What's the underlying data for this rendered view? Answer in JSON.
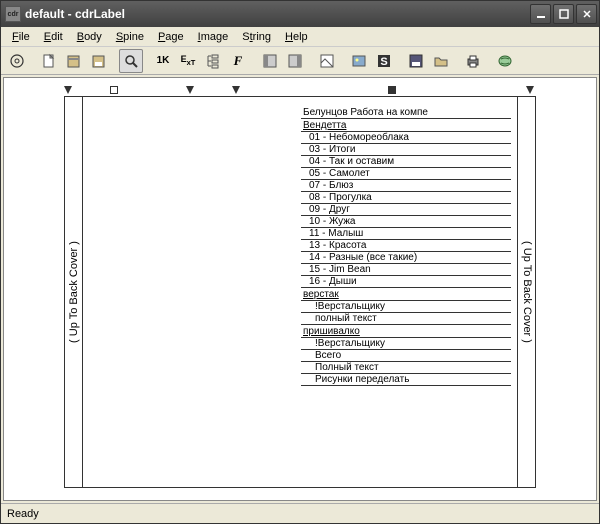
{
  "window": {
    "title": "default - cdrLabel"
  },
  "menu": {
    "file": "File",
    "edit": "Edit",
    "body": "Body",
    "spine": "Spine",
    "page": "Page",
    "image": "Image",
    "string": "String",
    "help": "Help"
  },
  "spine": {
    "left": "( Up To Back Cover )",
    "right": "( Up To Back Cover )"
  },
  "tracks": {
    "header": "Белунцов Работа на компе",
    "sections": [
      {
        "title": "Вендетта",
        "items": [
          "01 - Небомореоблака",
          "03 - Итоги",
          "04 - Так и оставим",
          "05 - Самолет",
          "07 - Блюз",
          "08 - Прогулка",
          "09 - Друг",
          "10 - Жужа",
          "11 - Малыш",
          "13 - Красота",
          "14 - Разные (все такие)",
          "15 - Jim Bean",
          "16 - Дыши"
        ]
      },
      {
        "title": "верстак",
        "items": [
          "!Верстальщику",
          "полный текст"
        ]
      },
      {
        "title": "пришивалко",
        "items": [
          "!Верстальщику",
          "Всего",
          "Полный текст",
          "Рисунки переделать"
        ]
      }
    ]
  },
  "status": "Ready"
}
